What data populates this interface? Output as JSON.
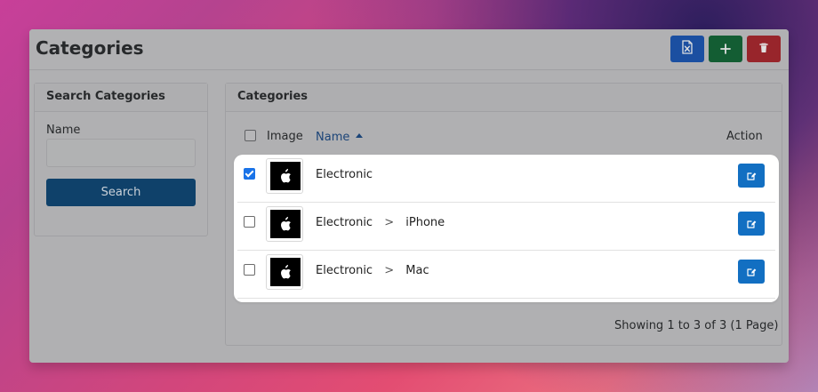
{
  "page": {
    "title": "Categories"
  },
  "header_actions": {
    "export_icon": "file-excel-icon",
    "add_icon": "plus-icon",
    "delete_icon": "trash-icon",
    "colors": {
      "export": "#1f5bb8",
      "add": "#166a3b",
      "delete": "#ad2b32"
    }
  },
  "search_panel": {
    "title": "Search Categories",
    "name_label": "Name",
    "name_value": "",
    "search_button": "Search"
  },
  "categories_panel": {
    "title": "Categories",
    "columns": {
      "image": "Image",
      "name": "Name",
      "action": "Action"
    },
    "sort_icon": "sort-ascending-icon",
    "rows": [
      {
        "checked": true,
        "image_icon": "apple-logo-icon",
        "path": [
          "Electronic"
        ],
        "action_icon": "edit-icon"
      },
      {
        "checked": false,
        "image_icon": "apple-logo-icon",
        "path": [
          "Electronic",
          "iPhone"
        ],
        "action_icon": "edit-icon"
      },
      {
        "checked": false,
        "image_icon": "apple-logo-icon",
        "path": [
          "Electronic",
          "Mac"
        ],
        "action_icon": "edit-icon"
      }
    ],
    "separator": ">",
    "status": "Showing 1 to 3 of 3 (1 Page)"
  },
  "colors": {
    "primary": "#126fc2",
    "header_link": "#1f4e89",
    "checkbox_checked": "#1a73e8"
  }
}
